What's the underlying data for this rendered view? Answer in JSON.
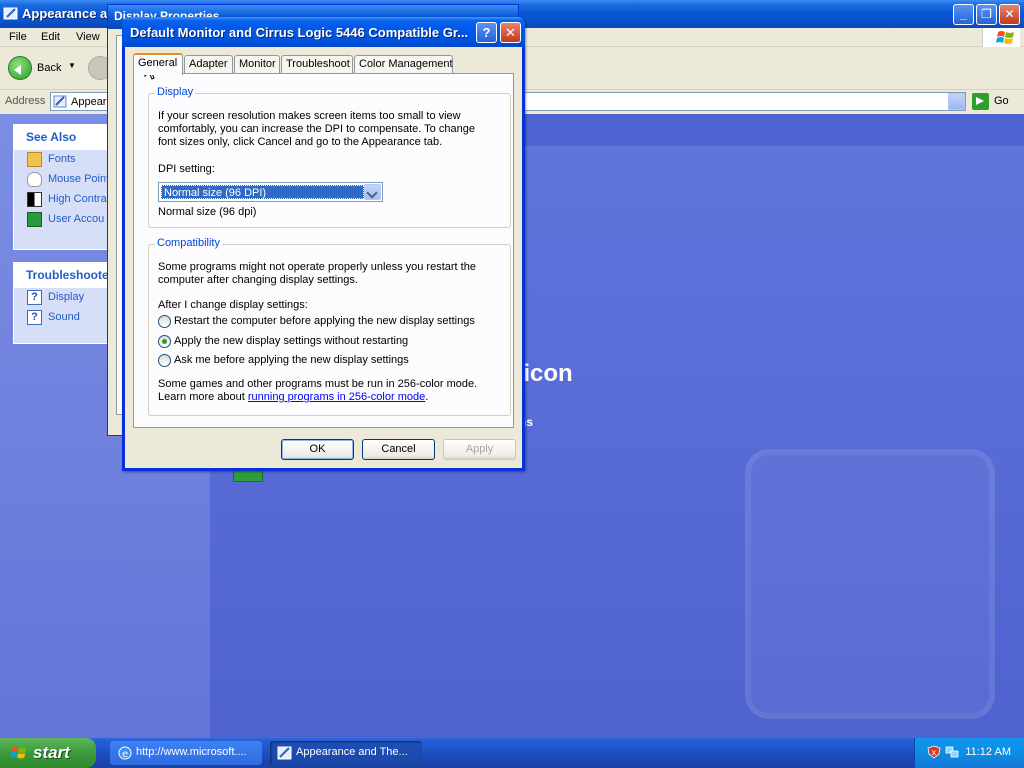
{
  "explorer": {
    "title": "Appearance a",
    "menu": [
      "File",
      "Edit",
      "View"
    ],
    "back_label": "Back",
    "address_label": "Address",
    "address_value": "Appear",
    "go_label": "Go",
    "see_also": {
      "header": "See Also",
      "items": [
        "Fonts",
        "Mouse Point",
        "High Contra",
        "User Accou"
      ]
    },
    "troubleshooters": {
      "header": "Troubleshoote",
      "items": [
        "Display",
        "Sound"
      ]
    },
    "bg_text_icon": "l icon",
    "bg_text_ns": "ns"
  },
  "display_properties": {
    "title": "Display Properties"
  },
  "dialog": {
    "title": "Default Monitor and Cirrus Logic 5446 Compatible Gr...",
    "tabs": [
      "General",
      "Adapter",
      "Monitor",
      "Troubleshoot",
      "Color Management"
    ],
    "display_group": {
      "legend": "Display",
      "description_lines": [
        "If your screen resolution makes screen items too small to view",
        "comfortably, you can increase the DPI to compensate.  To change",
        "font sizes only, click Cancel and go to the Appearance tab."
      ],
      "dpi_label": "DPI setting:",
      "dpi_selected": "Normal size (96 DPI)",
      "dpi_current": "Normal size (96 dpi)"
    },
    "compat_group": {
      "legend": "Compatibility",
      "description_lines": [
        "Some programs might not operate properly unless you restart the",
        "computer after changing display settings."
      ],
      "after_change_label": "After I change display settings:",
      "options": [
        {
          "label": "Restart the computer before applying the new display settings",
          "selected": false
        },
        {
          "label": "Apply the new display settings without restarting",
          "selected": true
        },
        {
          "label": "Ask me before applying the new display settings",
          "selected": false
        }
      ],
      "footer_line1": "Some games and other programs must be run in 256-color mode.",
      "footer_prefix": "Learn more about ",
      "footer_link": "running programs in 256-color mode",
      "footer_suffix": "."
    },
    "buttons": {
      "ok": "OK",
      "cancel": "Cancel",
      "apply": "Apply"
    }
  },
  "taskbar": {
    "start_label": "start",
    "tasks": [
      "http://www.microsoft....",
      "Appearance and The..."
    ],
    "clock": "11:12 AM"
  },
  "colors": {
    "xp_blue": "#0054e3",
    "link_blue": "#215dc6",
    "start_green": "#3c9a3a",
    "group_legend": "#0046d5"
  }
}
